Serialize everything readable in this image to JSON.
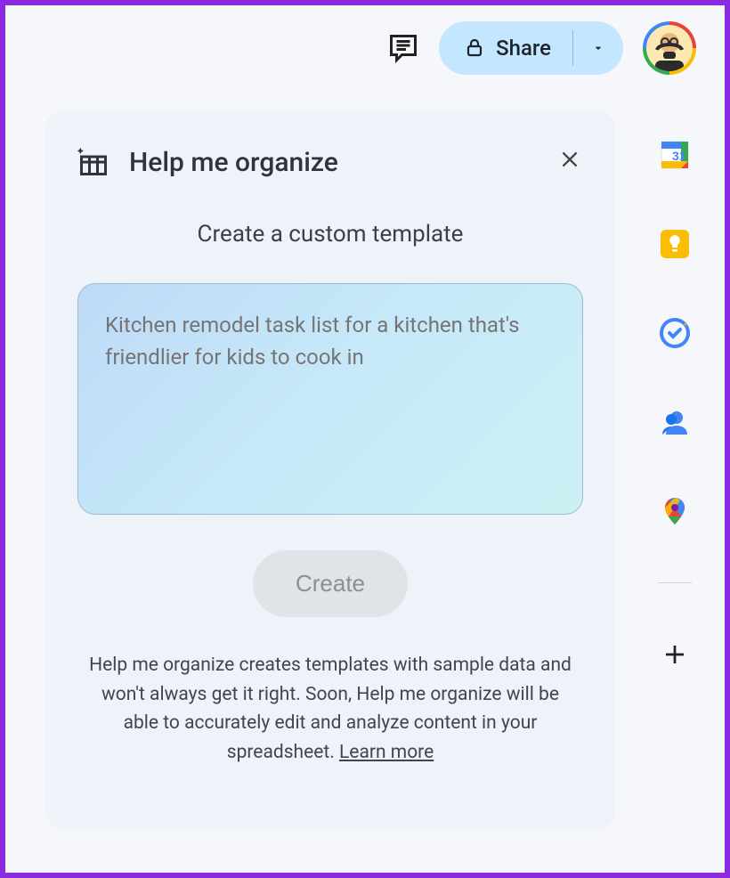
{
  "header": {
    "share_label": "Share"
  },
  "panel": {
    "title": "Help me organize",
    "subtitle": "Create a custom template",
    "placeholder": "Kitchen remodel task list for a kitchen that's friendlier for kids to cook in",
    "create_label": "Create",
    "disclaimer": "Help me organize creates templates with sample data and won't always get it right. Soon, Help me organize will be able to accurately edit and analyze content in your spreadsheet. ",
    "learn_more_label": "Learn more"
  },
  "sidebar": {
    "items": [
      {
        "name": "calendar"
      },
      {
        "name": "keep"
      },
      {
        "name": "tasks"
      },
      {
        "name": "contacts"
      },
      {
        "name": "maps"
      }
    ]
  }
}
